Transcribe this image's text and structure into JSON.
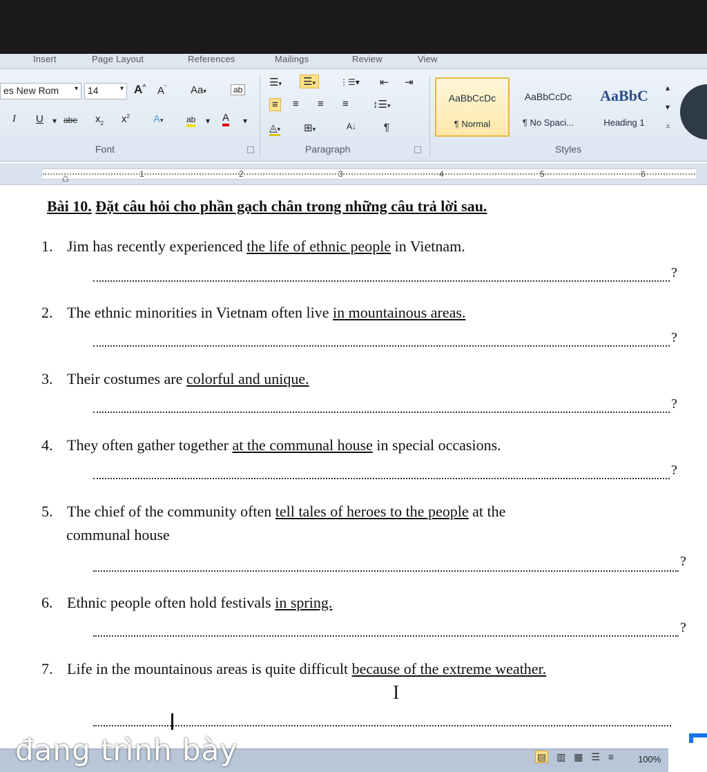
{
  "ribbon": {
    "tabs": [
      "Insert",
      "Page Layout",
      "References",
      "Mailings",
      "Review",
      "View"
    ],
    "font": {
      "name": "es New Rom",
      "size": "14",
      "group_label": "Font"
    },
    "paragraph": {
      "group_label": "Paragraph"
    },
    "styles": {
      "group_label": "Styles",
      "items": [
        {
          "sample": "AaBbCcDc",
          "name": "¶ Normal"
        },
        {
          "sample": "AaBbCcDc",
          "name": "¶ No Spaci..."
        },
        {
          "sample": "AaBbC",
          "name": "Heading 1"
        }
      ]
    }
  },
  "ruler": {
    "numbers": [
      "1",
      "2",
      "3",
      "4",
      "5",
      "6"
    ]
  },
  "document": {
    "title_pre": "Bài 10.",
    "title_rest": "Đặt câu hỏi cho phần gạch chân trong những câu trả lời sau.",
    "questions": [
      {
        "num": "1.",
        "before": "Jim has recently experienced ",
        "underlined": "the life of ethnic people",
        "after": " in Vietnam."
      },
      {
        "num": "2.",
        "before": "The ethnic minorities in Vietnam often live ",
        "underlined": "in mountainous areas.",
        "after": ""
      },
      {
        "num": "3.",
        "before": "Their costumes are ",
        "underlined": "colorful and unique.",
        "after": ""
      },
      {
        "num": "4.",
        "before": "They often gather together ",
        "underlined": "at the communal house",
        "after": " in special occasions."
      },
      {
        "num": "5.",
        "before": "The chief of the community often ",
        "underlined": "tell tales of heroes to the people",
        "after": " at the"
      },
      {
        "num": "6.",
        "before": "Ethnic people often hold festivals ",
        "underlined": "in spring.",
        "after": ""
      },
      {
        "num": "7.",
        "before": "Life in the mountainous areas is quite difficult ",
        "underlined": "because of the extreme weather.",
        "after": ""
      }
    ],
    "q5_continuation": "communal house",
    "question_mark": "?"
  },
  "status_bar": {
    "overlay_text": "đang trình bày",
    "zoom": "100%"
  }
}
